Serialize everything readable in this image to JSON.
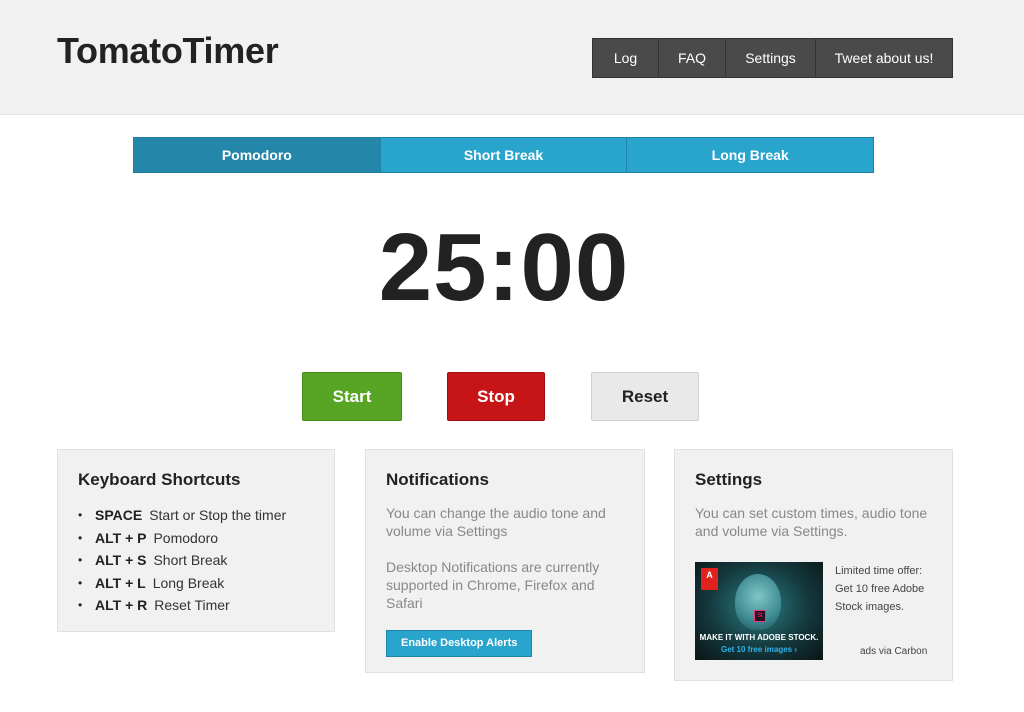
{
  "header": {
    "logo": "TomatoTimer",
    "nav": {
      "log": "Log",
      "faq": "FAQ",
      "settings": "Settings",
      "tweet": "Tweet about us!"
    }
  },
  "tabs": [
    {
      "label": "Pomodoro",
      "active": true
    },
    {
      "label": "Short Break",
      "active": false
    },
    {
      "label": "Long Break",
      "active": false
    }
  ],
  "timer": {
    "display": "25:00"
  },
  "controls": {
    "start": "Start",
    "stop": "Stop",
    "reset": "Reset"
  },
  "keyboard": {
    "title": "Keyboard Shortcuts",
    "shortcuts": [
      {
        "key": "SPACE",
        "action": "Start or Stop the timer"
      },
      {
        "key": "ALT + P",
        "action": "Pomodoro"
      },
      {
        "key": "ALT + S",
        "action": "Short Break"
      },
      {
        "key": "ALT + L",
        "action": "Long Break"
      },
      {
        "key": "ALT + R",
        "action": "Reset Timer"
      }
    ]
  },
  "notifications": {
    "title": "Notifications",
    "text1": "You can change the audio tone and volume via Settings",
    "text2": "Desktop Notifications are currently supported in Chrome, Firefox and Safari",
    "button": "Enable Desktop Alerts"
  },
  "settings": {
    "title": "Settings",
    "text": "You can set custom times, audio tone and volume via Settings.",
    "ad": {
      "logo": "A",
      "product_badge": "St",
      "image_line1": "MAKE IT WITH ADOBE STOCK.",
      "image_line2": "Get 10 free images ›",
      "text": "Limited time offer: Get 10 free Adobe Stock images.",
      "via": "ads via Carbon"
    }
  },
  "colors": {
    "tab_active": "#2486a9",
    "tab": "#29a4cd",
    "start": "#58a425",
    "stop": "#c71417",
    "reset": "#e9e9e9",
    "nav": "#4a4a4a"
  }
}
